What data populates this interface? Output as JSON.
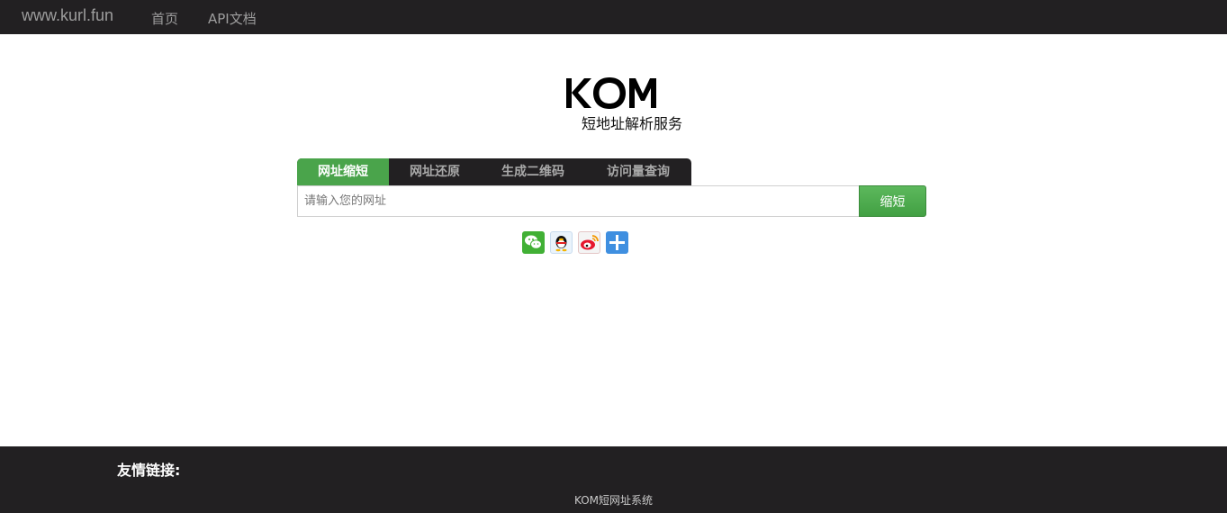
{
  "navbar": {
    "brand": "www.kurl.fun",
    "links": [
      {
        "label": "首页"
      },
      {
        "label": "API文档"
      }
    ]
  },
  "hero": {
    "logo_text": "KOM",
    "subtitle": "短地址解析服务"
  },
  "tabs": [
    {
      "label": "网址缩短",
      "active": true
    },
    {
      "label": "网址还原",
      "active": false
    },
    {
      "label": "生成二维码",
      "active": false
    },
    {
      "label": "访问量查询",
      "active": false
    }
  ],
  "form": {
    "placeholder": "请输入您的网址",
    "value": "",
    "submit_label": "缩短"
  },
  "share": {
    "icons": [
      "wechat-icon",
      "qq-icon",
      "weibo-icon",
      "more-share-icon"
    ]
  },
  "footer": {
    "friend_links_label": "友情链接:",
    "copyright": "KOM短网址系统"
  },
  "colors": {
    "navbar_bg": "#222022",
    "accent_green": "#4aa44b",
    "nav_text": "#9d9d9d"
  }
}
